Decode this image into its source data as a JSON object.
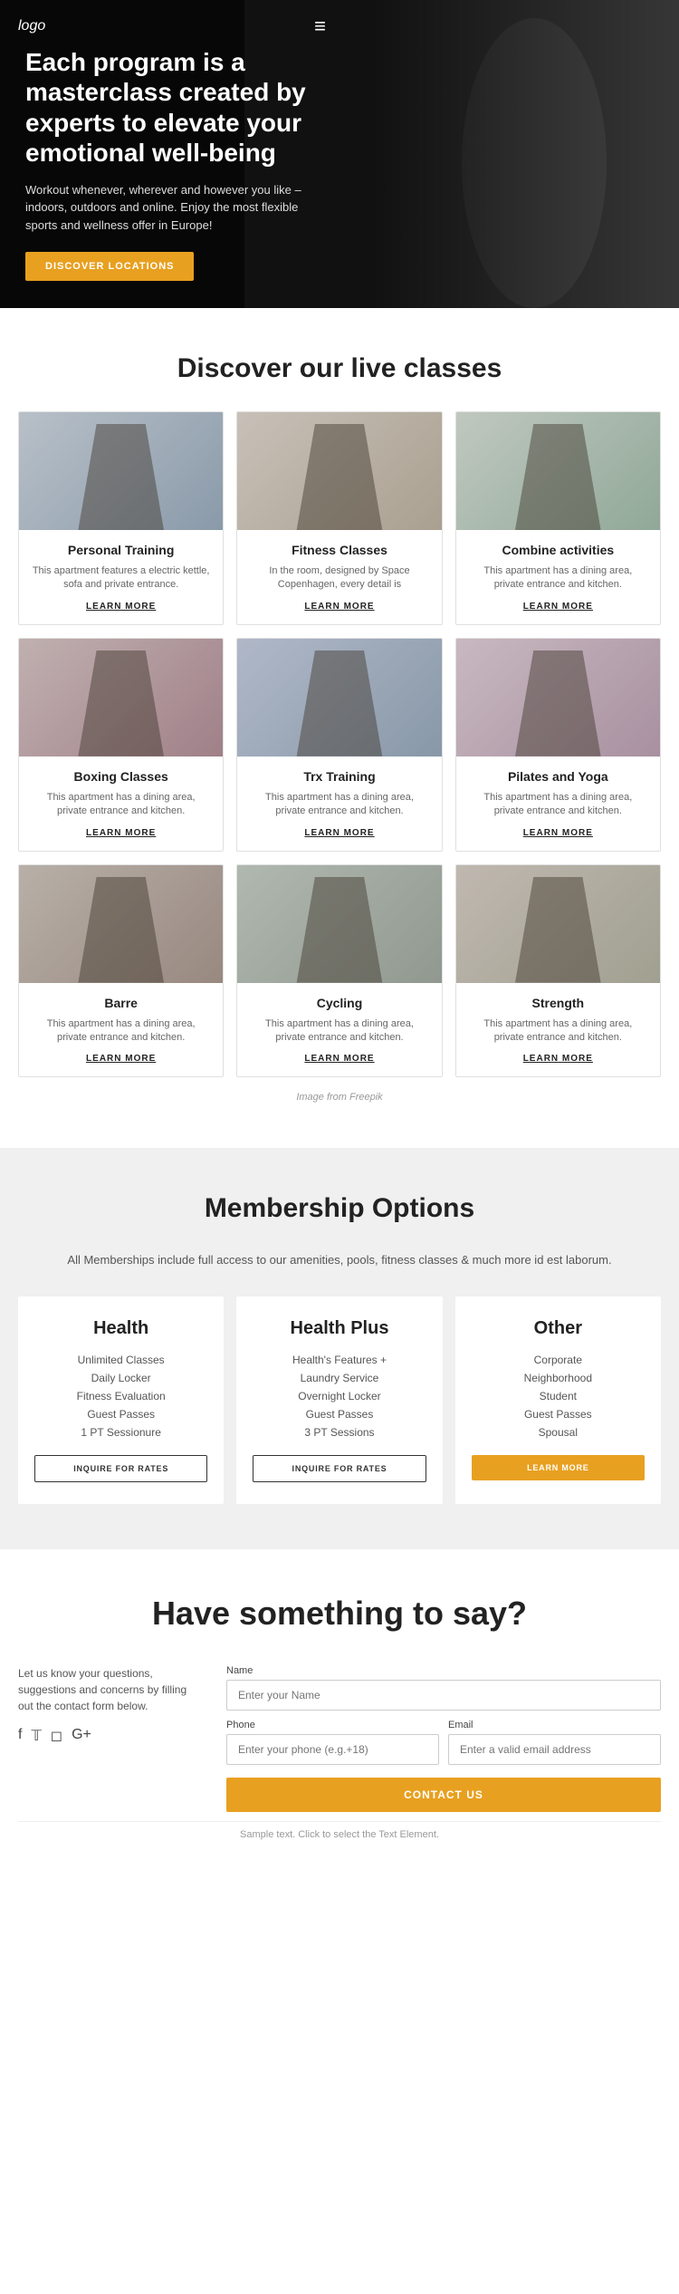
{
  "header": {
    "logo": "logo",
    "menu_icon": "≡"
  },
  "hero": {
    "title": "Each program is a masterclass created by experts to elevate your emotional well-being",
    "description": "Workout whenever, wherever and however you like – indoors, outdoors and online. Enjoy the most flexible sports and wellness offer in Europe!",
    "cta_label": "DISCOVER LOCATIONS"
  },
  "classes_section": {
    "title": "Discover our live classes",
    "freepik_note": "Image from Freepik",
    "cards": [
      {
        "img_class": "img1",
        "title": "Personal Training",
        "description": "This apartment features a electric kettle, sofa and private entrance.",
        "link": "LEARN MORE"
      },
      {
        "img_class": "img2",
        "title": "Fitness Classes",
        "description": "In the room, designed by Space Copenhagen, every detail is",
        "link": "LEARN MORE"
      },
      {
        "img_class": "img3",
        "title": "Combine activities",
        "description": "This apartment has a dining area, private entrance and kitchen.",
        "link": "LEARN MORE"
      },
      {
        "img_class": "img4",
        "title": "Boxing Classes",
        "description": "This apartment has a dining area, private entrance and kitchen.",
        "link": "LEARN MORE"
      },
      {
        "img_class": "img5",
        "title": "Trx Training",
        "description": "This apartment has a dining area, private entrance and kitchen.",
        "link": "LEARN MORE"
      },
      {
        "img_class": "img6",
        "title": "Pilates and Yoga",
        "description": "This apartment has a dining area, private entrance and kitchen.",
        "link": "LEARN MORE"
      },
      {
        "img_class": "img7",
        "title": "Barre",
        "description": "This apartment has a dining area, private entrance and kitchen.",
        "link": "LEARN MORE"
      },
      {
        "img_class": "img8",
        "title": "Cycling",
        "description": "This apartment has a dining area, private entrance and kitchen.",
        "link": "LEARN MORE"
      },
      {
        "img_class": "img9",
        "title": "Strength",
        "description": "This apartment has a dining area, private entrance and kitchen.",
        "link": "LEARN MORE"
      }
    ]
  },
  "membership_section": {
    "title": "Membership Options",
    "description": "All Memberships include full access to our amenities, pools, fitness classes & much more id est laborum.",
    "plans": [
      {
        "title": "Health",
        "features": [
          "Unlimited Classes",
          "Daily Locker",
          "Fitness Evaluation",
          "Guest Passes",
          "1 PT Sessionure"
        ],
        "btn_label": "INQUIRE FOR RATES",
        "btn_style": "outline"
      },
      {
        "title": "Health Plus",
        "features": [
          "Health's Features +",
          "Laundry Service",
          "Overnight Locker",
          "Guest Passes",
          "3 PT Sessions"
        ],
        "btn_label": "INQUIRE FOR RATES",
        "btn_style": "outline"
      },
      {
        "title": "Other",
        "features": [
          "Corporate",
          "Neighborhood",
          "Student",
          "Guest Passes",
          "Spousal"
        ],
        "btn_label": "LEARN MORE",
        "btn_style": "solid"
      }
    ]
  },
  "contact_section": {
    "title": "Have something to say?",
    "left_text": "Let us know your questions, suggestions and concerns by filling out the contact form below.",
    "social_icons": [
      "f",
      "𝕋",
      "◻",
      "G⁺"
    ],
    "form": {
      "name_label": "Name",
      "name_placeholder": "Enter your Name",
      "phone_label": "Phone",
      "phone_placeholder": "Enter your phone (e.g.+18)",
      "email_label": "Email",
      "email_placeholder": "Enter a valid email address",
      "submit_label": "CONTACT US"
    },
    "sample_text": "Sample text. Click to select the Text Element."
  }
}
